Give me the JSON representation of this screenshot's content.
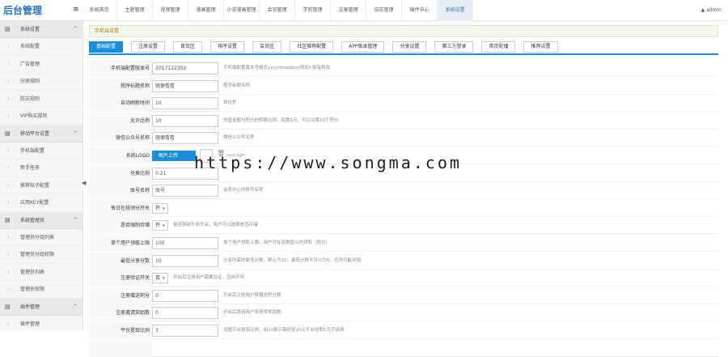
{
  "brand": "后台管理",
  "top_nav": [
    "系统首页",
    "主题管理",
    "视频管理",
    "漫画管理",
    "小说漫画管理",
    "会员管理",
    "学院管理",
    "文章管理",
    "日志管理",
    "插件中心",
    "系统设置"
  ],
  "top_nav_active": "系统设置",
  "user": "admin",
  "sidebar": [
    {
      "group": "系统设置",
      "items": [
        "系统配置",
        "广告管理",
        "分类规则",
        "防灾规则",
        "VIP购买规则"
      ]
    },
    {
      "group": "移动平台设置",
      "items": [
        "手机端配置",
        "新手任务",
        "推荐帖子配置",
        "应用KEY配置"
      ]
    },
    {
      "group": "系统管理员",
      "items": [
        "管理员分组列表",
        "管理员分组权限",
        "管理员列表",
        "管理员权限"
      ]
    },
    {
      "group": "插件管理",
      "items": [
        "插件管理"
      ]
    }
  ],
  "breadcrumb": "手机端设置",
  "tabs": [
    "基础配置",
    "注册设置",
    "首页区",
    "排序设置",
    "会员区",
    "社区推荐配置",
    "APP版本管理",
    "分享设置",
    "第三方登录",
    "首页轮播",
    "推荐设置"
  ],
  "form_rows": [
    {
      "label": "手机端配置版本号",
      "value": "2017122302",
      "help": "手机端配置版本号格式yyyymmddnn(例如)-如有修改"
    },
    {
      "label": "程序标题名称",
      "value": "随便看看",
      "help": "程序标题名称"
    },
    {
      "label": "自动刷新时间",
      "value": "10",
      "help": "单位秒"
    },
    {
      "label": "允许比例",
      "value": "10",
      "help": "充值金额与积分的转换比例。如置1元，可以兑换10个积分"
    },
    {
      "label": "微信公众号名称",
      "value": "随便看看",
      "help": "微信公众号名称"
    },
    {
      "label": "系统LOGO",
      "type": "upload",
      "button": "图片上传",
      "help": "sysLogo"
    },
    {
      "label": "兑换比例",
      "value": "0.21",
      "help": ""
    },
    {
      "label": "账号名称",
      "value": "账号",
      "help": "会员中心的账号名称"
    },
    {
      "label": "每日在线领分开关",
      "type": "select",
      "value": "开",
      "help": ""
    },
    {
      "label": "是否强制存储",
      "type": "select",
      "value": "开",
      "help": "是否强制开启开关，用户可以选择是否存储"
    },
    {
      "label": "单个用户领取上限",
      "value": "100",
      "help": "单个用户领取上限，用户可在该数值以内领取（积分）"
    },
    {
      "label": "最低分享分数",
      "value": "10",
      "help": "分享所需的最低分数，默认为10，最低分数不可以为0，否则可能出错"
    },
    {
      "label": "注册验证开关",
      "type": "select",
      "value": "否",
      "help": "开启后注册用户需要验证，否则不开"
    },
    {
      "label": "注册赠送积分",
      "value": "0",
      "help": "开启后注册用户将赠送积分数"
    },
    {
      "label": "注册邀请奖励数",
      "value": "0",
      "help": "开启后邀请用户将获得奖励数"
    },
    {
      "label": "平台提现比例",
      "value": "3",
      "help": "设置平台提现比例，如10表示每提现10元平台收取1元手续费"
    },
    {
      "label": "",
      "value": "",
      "help": ""
    }
  ],
  "watermark": "https://www.songma.com"
}
